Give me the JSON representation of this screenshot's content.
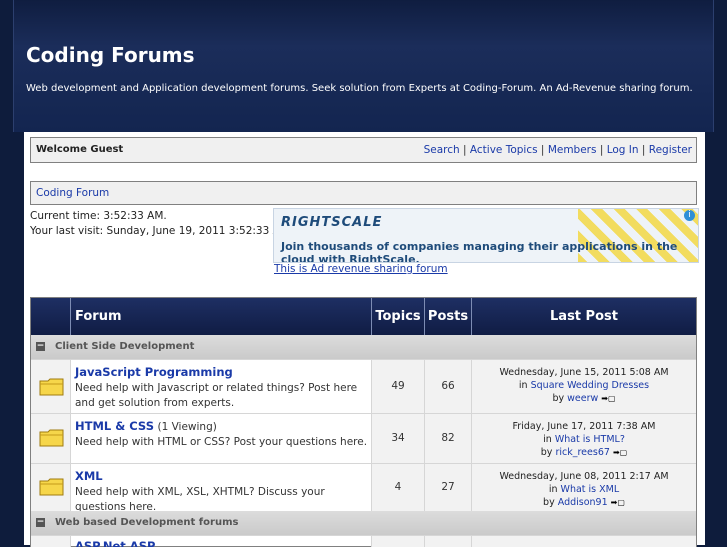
{
  "header": {
    "title": "Coding Forums",
    "subtitle": "Web development and Application development forums. Seek solution from Experts at Coding-Forum. An Ad-Revenue sharing forum."
  },
  "welcome": {
    "guest": "Welcome Guest",
    "links": [
      "Search",
      "Active Topics",
      "Members",
      "Log In",
      "Register"
    ],
    "separator": " | "
  },
  "breadcrumb": {
    "label": "Coding Forum"
  },
  "time": {
    "current": "Current time: 3:52:33 AM.",
    "last_visit": "Your last visit: Sunday, June 19, 2011 3:52:33 AM."
  },
  "ad": {
    "logo": "RIGHTSCALE",
    "message": "Join thousands of companies managing their applications in the cloud with RightScale.",
    "close": "i",
    "link": "This is Ad revenue sharing forum"
  },
  "table": {
    "headers": {
      "forum": "Forum",
      "topics": "Topics",
      "posts": "Posts",
      "last_post": "Last Post"
    },
    "categories": [
      {
        "name": "Client Side Development",
        "toggle": "−"
      },
      {
        "name": "Web based Development forums",
        "toggle": "−"
      }
    ],
    "forums": [
      {
        "name": "JavaScript Programming",
        "viewing": "",
        "description": "Need help with Javascript or related things? Post here and get solution from experts.",
        "topics": "49",
        "posts": "66",
        "last_date": "Wednesday, June 15, 2011 5:08 AM",
        "in_prefix": "in",
        "last_topic": "Square Wedding Dresses",
        "by_prefix": "by",
        "last_user": "weerw"
      },
      {
        "name": "HTML & CSS",
        "viewing": "(1 Viewing)",
        "description": "Need help with HTML or CSS? Post your questions here.",
        "topics": "34",
        "posts": "82",
        "last_date": "Friday, June 17, 2011 7:38 AM",
        "in_prefix": "in",
        "last_topic": "What is HTML?",
        "by_prefix": "by",
        "last_user": "rick_rees67"
      },
      {
        "name": "XML",
        "viewing": "",
        "description": "Need help with XML, XSL, XHTML? Discuss your questions here.",
        "topics": "4",
        "posts": "27",
        "last_date": "Wednesday, June 08, 2011 2:17 AM",
        "in_prefix": "in",
        "last_topic": "What is XML",
        "by_prefix": "by",
        "last_user": "Addison91"
      },
      {
        "name": "ASP.Net ASP",
        "viewing": "",
        "description": "",
        "topics": "",
        "posts": "",
        "last_date": "",
        "in_prefix": "",
        "last_topic": "",
        "by_prefix": "",
        "last_user": ""
      }
    ]
  },
  "colors": {
    "header_bg": "#1b2d5a",
    "link": "#1a3aa8",
    "folder": "#f6d64a"
  },
  "icons": {
    "folder": "folder-icon",
    "goto": "goto-last-post-icon",
    "toggle": "collapse-icon"
  }
}
